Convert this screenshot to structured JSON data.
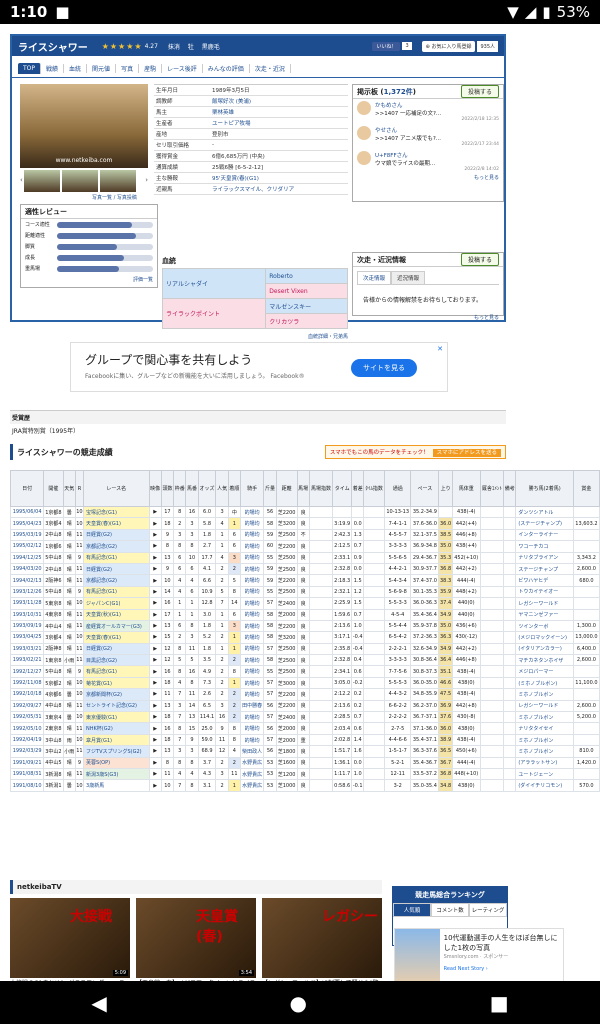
{
  "status": {
    "time": "1:10",
    "battery": "53%"
  },
  "horse": {
    "name": "ライスシャワー",
    "stars": "★★★★★",
    "rating": "4.27",
    "status": "抹消",
    "sex": "牡",
    "color": "黒鹿毛",
    "like_label": "いいね！",
    "like_count": "3",
    "fav_label": "お気に入り馬登録",
    "fav_count": "935人"
  },
  "tabs": [
    "TOP",
    "戦績",
    "血統",
    "関元値",
    "写真",
    "産駒",
    "レース後評",
    "みんなの評価",
    "次走・近況"
  ],
  "profile": [
    {
      "k": "生年月日",
      "v": "1989年3月5日",
      "plain": true
    },
    {
      "k": "調教師",
      "v": "飯塚好次 (美浦)"
    },
    {
      "k": "馬主",
      "v": "栗林英雄"
    },
    {
      "k": "生産者",
      "v": "ユートピア牧場"
    },
    {
      "k": "産地",
      "v": "登別市",
      "plain": true
    },
    {
      "k": "セリ取引価格",
      "v": "-",
      "plain": true
    },
    {
      "k": "獲得賞金",
      "v": "6億6,685万円 (中央)",
      "plain": true
    },
    {
      "k": "通算成績",
      "v": "25戦6勝 [6-5-2-12]",
      "plain": true
    },
    {
      "k": "主な勝鞍",
      "v": "95'天皇賞(春)(G1)"
    },
    {
      "k": "近親馬",
      "v": "ライラックスマイル、クリダリア"
    }
  ],
  "photo": {
    "watermark": "www.netkeiba.com",
    "links": "写真一覧 / 写真投稿"
  },
  "board": {
    "title": "掲示板",
    "count": "1,372件",
    "post_button": "投稿する",
    "posts": [
      {
        "user": "かもめさん",
        "msg": ">>1407 一応補足の文?...",
        "date": "2022/2/18 12:35"
      },
      {
        "user": "やせさん",
        "msg": ">>1407 アニメ版でも?...",
        "date": "2022/2/17 23:44"
      },
      {
        "user": "U+F8FFさん",
        "msg": "ウマ娘でライスの最期...",
        "date": "2022/2/8 14:02"
      }
    ],
    "more": "もっと見る"
  },
  "review": {
    "title": "適性レビュー",
    "rows": [
      {
        "k": "コース適性",
        "v": 0.78
      },
      {
        "k": "距離適性",
        "v": 0.82
      },
      {
        "k": "脚質",
        "v": 0.62
      },
      {
        "k": "成長",
        "v": 0.7
      },
      {
        "k": "重馬場",
        "v": 0.65
      }
    ],
    "link": "評価一覧"
  },
  "pedigree": {
    "title": "血統",
    "sire": "リアルシャダイ",
    "dam": "ライラックポイント",
    "ss": "Roberto",
    "sd": "Desert Vixen",
    "ds": "マルゼンスキー",
    "dd": "クリカツラ",
    "link": "血統詳細・兄弟馬"
  },
  "nextrace": {
    "title": "次走・近況情報",
    "post_button": "投稿する",
    "tabs": [
      "次走情報",
      "近況情報"
    ],
    "message": "告様からの情報解禁をお待ちしております。",
    "more": "もっと見る"
  },
  "ad": {
    "headline": "グループで関心事を共有しよう",
    "sub": "Facebookに集い、グループなどの新機能を大いに活用しましょう。 Facebook®",
    "cta": "サイトを見る",
    "close": "✕"
  },
  "prize": {
    "title": "受賞歴",
    "value": "JRA賞特別賞（1995年）"
  },
  "results": {
    "title": "ライスシャワーの競走成績",
    "promo": "スマホでもこの馬のデータをチェック！",
    "promo_btn": "スマホにアドレスを送る",
    "headers": [
      "日付",
      "開催",
      "天気",
      "R",
      "レース名",
      "映像",
      "頭数",
      "枠番",
      "馬番",
      "オッズ",
      "人気",
      "着順",
      "騎手",
      "斤量",
      "距離",
      "馬場",
      "馬場指数",
      "タイム",
      "着差",
      "ﾀｲﾑ指数",
      "通過",
      "ペース",
      "上り",
      "馬体重",
      "厩舎ｺﾒﾝﾄ",
      "備考",
      "勝ち馬(2着馬)",
      "賞金"
    ],
    "rows": [
      [
        "1995/06/04",
        "1京都8",
        "曇",
        "10",
        "宝塚記念(G1)",
        "G1",
        "17",
        "8",
        "16",
        "6.0",
        "3",
        "中",
        "的場均",
        "56",
        "芝2200",
        "良",
        "",
        "",
        "",
        "",
        "10-13-13",
        "35.2-34.9",
        "",
        "438(-4)",
        "",
        "",
        "ダンツシアトル",
        ""
      ],
      [
        "1995/04/23",
        "3京都4",
        "晴",
        "10",
        "天皇賞(春)(G1)",
        "G1",
        "18",
        "2",
        "3",
        "5.8",
        "4",
        "1",
        "的場均",
        "58",
        "芝3200",
        "良",
        "",
        "3:19.9",
        "0.0",
        "",
        "7-4-1-1",
        "37.6-36.0",
        "36.0",
        "442(+4)",
        "",
        "",
        "(ステージチャンプ)",
        "13,603.2"
      ],
      [
        "1995/03/19",
        "2中山8",
        "晴",
        "11",
        "日経賞(G2)",
        "G2",
        "9",
        "3",
        "3",
        "1.8",
        "1",
        "6",
        "的場均",
        "59",
        "芝2500",
        "不",
        "",
        "2:42.3",
        "1.3",
        "",
        "4-5-5-7",
        "32.1-37.5",
        "38.5",
        "446(+8)",
        "",
        "",
        "インターライナー",
        ""
      ],
      [
        "1995/02/12",
        "1京都6",
        "晴",
        "11",
        "京都記念(G2)",
        "G2",
        "8",
        "8",
        "8",
        "2.7",
        "1",
        "6",
        "的場均",
        "60",
        "芝2200",
        "良",
        "",
        "2:12.5",
        "0.7",
        "",
        "3-3-3-3",
        "36.9-34.8",
        "35.0",
        "438(+4)",
        "",
        "",
        "ワコーチカコ",
        ""
      ],
      [
        "1994/12/25",
        "5中山8",
        "晴",
        "9",
        "有馬記念(G1)",
        "G1",
        "13",
        "6",
        "10",
        "17.7",
        "4",
        "3",
        "的場均",
        "55",
        "芝2500",
        "良",
        "",
        "2:33.1",
        "0.9",
        "",
        "5-5-6-5",
        "29.4-36.7",
        "35.3",
        "452(+10)",
        "",
        "",
        "ナリタブライアン",
        "3,343.2"
      ],
      [
        "1994/03/20",
        "2中山8",
        "晴",
        "11",
        "日経賞(G2)",
        "G2",
        "9",
        "6",
        "6",
        "4.1",
        "2",
        "2",
        "的場均",
        "59",
        "芝2500",
        "良",
        "",
        "2:32.8",
        "0.0",
        "",
        "4-4-2-1",
        "30.9-37.7",
        "36.8",
        "442(+2)",
        "",
        "",
        "ステージチャンプ",
        "2,600.0"
      ],
      [
        "1994/02/13",
        "2阪神6",
        "晴",
        "11",
        "京都記念(G2)",
        "G2",
        "10",
        "4",
        "4",
        "6.6",
        "2",
        "5",
        "的場均",
        "59",
        "芝2200",
        "良",
        "",
        "2:18.3",
        "1.5",
        "",
        "5-4-3-4",
        "37.4-37.0",
        "38.3",
        "444(-4)",
        "",
        "",
        "ビワハヤヒデ",
        "680.0"
      ],
      [
        "1993/12/26",
        "5中山8",
        "晴",
        "9",
        "有馬記念(G1)",
        "G1",
        "14",
        "4",
        "6",
        "10.9",
        "5",
        "8",
        "的場均",
        "55",
        "芝2500",
        "良",
        "",
        "2:32.1",
        "1.2",
        "",
        "5-6-9-8",
        "30.1-35.3",
        "35.9",
        "448(+2)",
        "",
        "",
        "トウカイテイオー",
        ""
      ],
      [
        "1993/11/28",
        "5東京8",
        "晴",
        "10",
        "ジャパンC(G1)",
        "G1",
        "16",
        "1",
        "1",
        "12.8",
        "7",
        "14",
        "的場均",
        "57",
        "芝2400",
        "良",
        "",
        "2:25.9",
        "1.5",
        "",
        "5-5-3-3",
        "36.0-36.3",
        "37.4",
        "440(0)",
        "",
        "",
        "レガシーワールド",
        ""
      ],
      [
        "1993/10/31",
        "4東京8",
        "晴",
        "11",
        "天皇賞(秋)(G1)",
        "G1",
        "17",
        "1",
        "1",
        "3.0",
        "1",
        "6",
        "的場均",
        "58",
        "芝2000",
        "良",
        "",
        "1:59.6",
        "0.7",
        "",
        "4-5-4",
        "35.4-36.4",
        "34.9",
        "440(0)",
        "",
        "",
        "ヤマニンゼファー",
        ""
      ],
      [
        "1993/09/19",
        "4中山4",
        "晴",
        "11",
        "産経賞オールカマー(G3)",
        "G3",
        "13",
        "6",
        "8",
        "1.8",
        "1",
        "3",
        "的場均",
        "58",
        "芝2200",
        "良",
        "",
        "2:13.6",
        "1.0",
        "",
        "5-5-4-4",
        "35.9-37.8",
        "35.0",
        "436(+6)",
        "",
        "",
        "ツインターボ",
        "1,300.0"
      ],
      [
        "1993/04/25",
        "3京都4",
        "晴",
        "10",
        "天皇賞(春)(G1)",
        "G1",
        "15",
        "2",
        "3",
        "5.2",
        "2",
        "1",
        "的場均",
        "58",
        "芝3200",
        "良",
        "",
        "3:17.1",
        "-0.4",
        "",
        "6-5-4-2",
        "37.2-36.3",
        "36.3",
        "430(-12)",
        "",
        "",
        "(メジロマックイーン)",
        "13,000.0"
      ],
      [
        "1993/03/21",
        "2阪神8",
        "晴",
        "11",
        "日経賞(G2)",
        "G2",
        "12",
        "8",
        "11",
        "1.8",
        "1",
        "1",
        "的場均",
        "57",
        "芝2500",
        "良",
        "",
        "2:35.8",
        "-0.4",
        "",
        "2-2-2-1",
        "32.6-34.9",
        "34.9",
        "442(+2)",
        "",
        "",
        "(イタリアンカラー)",
        "6,400.0"
      ],
      [
        "1993/02/21",
        "1東京8",
        "小雨",
        "11",
        "目黒記念(G2)",
        "G2",
        "12",
        "5",
        "5",
        "3.5",
        "2",
        "2",
        "的場均",
        "58",
        "芝2500",
        "良",
        "",
        "2:32.8",
        "0.4",
        "",
        "3-3-3-3",
        "30.8-36.4",
        "36.4",
        "446(+8)",
        "",
        "",
        "マチカネタンホイザ",
        "2,600.0"
      ],
      [
        "1992/12/27",
        "5中山8",
        "晴",
        "9",
        "有馬記念(G1)",
        "G1",
        "16",
        "8",
        "16",
        "4.9",
        "2",
        "8",
        "的場均",
        "55",
        "芝2500",
        "良",
        "",
        "2:34.1",
        "0.6",
        "",
        "7-7-5-6",
        "30.8-37.3",
        "35.1",
        "438(-4)",
        "",
        "",
        "メジロパーマー",
        ""
      ],
      [
        "1992/11/08",
        "5京都2",
        "晴",
        "10",
        "菊花賞(G1)",
        "G1",
        "18",
        "4",
        "8",
        "7.3",
        "2",
        "1",
        "的場均",
        "57",
        "芝3000",
        "良",
        "",
        "3:05.0",
        "-0.2",
        "",
        "5-5-5-3",
        "36.0-35.0",
        "46.6",
        "438(0)",
        "",
        "",
        "(ミホノブルボン)",
        "11,100.0"
      ],
      [
        "1992/10/18",
        "4京都6",
        "曇",
        "10",
        "京都新聞杯(G2)",
        "G2",
        "11",
        "7",
        "11",
        "2.6",
        "2",
        "2",
        "的場均",
        "57",
        "芝2200",
        "良",
        "",
        "2:12.2",
        "0.2",
        "",
        "4-4-3-2",
        "34.8-35.9",
        "47.5",
        "438(-4)",
        "",
        "",
        "ミホノブルボン",
        ""
      ],
      [
        "1992/09/27",
        "4中山8",
        "晴",
        "11",
        "セントライト記念(G2)",
        "G2",
        "13",
        "3",
        "14",
        "6.5",
        "3",
        "2",
        "田中勝春",
        "56",
        "芝2200",
        "良",
        "",
        "2:13.6",
        "0.2",
        "",
        "6-6-2-2",
        "36.2-37.0",
        "36.9",
        "442(+8)",
        "",
        "",
        "レガシーワールド",
        "2,600.0"
      ],
      [
        "1992/05/31",
        "3東京4",
        "曇",
        "10",
        "東京優駿(G1)",
        "G1",
        "18",
        "7",
        "13",
        "114.1",
        "16",
        "2",
        "的場均",
        "57",
        "芝2400",
        "良",
        "",
        "2:28.5",
        "0.7",
        "",
        "2-2-2-2",
        "36.7-37.1",
        "37.6",
        "430(-8)",
        "",
        "",
        "ミホノブルボン",
        "5,200.0"
      ],
      [
        "1992/05/10",
        "2東京8",
        "晴",
        "11",
        "NHK杯(G2)",
        "G2",
        "16",
        "8",
        "15",
        "25.0",
        "9",
        "8",
        "的場均",
        "56",
        "芝2000",
        "良",
        "",
        "2:03.4",
        "0.6",
        "",
        "2-7-5",
        "37.1-36.0",
        "36.0",
        "438(0)",
        "",
        "",
        "ナリタタイセイ",
        ""
      ],
      [
        "1992/04/19",
        "3中山8",
        "雨",
        "10",
        "皐月賞(G1)",
        "G1",
        "18",
        "7",
        "9",
        "59.0",
        "11",
        "8",
        "的場均",
        "57",
        "芝2000",
        "重",
        "",
        "2:02.8",
        "1.4",
        "",
        "4-4-6-6",
        "35.4-37.1",
        "38.9",
        "438(-4)",
        "",
        "",
        "ミホノブルボン",
        ""
      ],
      [
        "1992/03/29",
        "3中山2",
        "小雨",
        "11",
        "フジTVスプリングS(G2)",
        "G2",
        "13",
        "3",
        "3",
        "68.9",
        "12",
        "4",
        "柴田政人",
        "56",
        "芝1800",
        "良",
        "",
        "1:51.7",
        "1.6",
        "",
        "1-5-1-7",
        "36.3-37.6",
        "36.5",
        "450(+6)",
        "",
        "",
        "ミホノブルボン",
        "810.0"
      ],
      [
        "1991/09/21",
        "4中山5",
        "晴",
        "9",
        "芙蓉S(OP)",
        "OP",
        "8",
        "8",
        "8",
        "3.7",
        "2",
        "2",
        "水野貴広",
        "53",
        "芝1600",
        "良",
        "",
        "1:36.1",
        "0.0",
        "",
        "5-2-1",
        "35.4-36.7",
        "36.7",
        "444(-4)",
        "",
        "",
        "(アララットサン)",
        "1,420.0"
      ],
      [
        "1991/08/31",
        "3新潟8",
        "晴",
        "11",
        "新潟3歳S(G3)",
        "G3",
        "11",
        "4",
        "4",
        "4.3",
        "3",
        "11",
        "水野貴広",
        "53",
        "芝1200",
        "良",
        "",
        "1:11.7",
        "1.0",
        "",
        "12-11",
        "33.5-37.2",
        "36.8",
        "448(+10)",
        "",
        "",
        "ユートジェーン",
        ""
      ],
      [
        "1991/08/10",
        "3新潟1",
        "曇",
        "10",
        "3歳新馬",
        "",
        "10",
        "7",
        "8",
        "3.1",
        "2",
        "1",
        "水野貴広",
        "53",
        "芝1000",
        "良",
        "",
        "0:58.6",
        "-0.1",
        "",
        "3-2",
        "35.0-35.4",
        "34.8",
        "438(0)",
        "",
        "",
        "(ダイイチリコモン)",
        "570.0"
      ]
    ]
  },
  "tv": {
    "title": "netkeibaTV",
    "cards": [
      {
        "overlay": "大接戦",
        "duration": "5:09",
        "caption": "大接戦のG1まとめ！ グラスワンダーvs スペシャルウィークなど名勝負を一挙振り返"
      },
      {
        "overlay": "天皇賞(春)",
        "duration": "3:54",
        "caption": "【天皇賞・春】メジロマックイーンとライスシャワー、平成最強ステイヤーたちの名"
      },
      {
        "overlay": "レガシー",
        "duration": "",
        "caption": "【レガシーワールド】JC制覇して騒せた\"驚異の二の脚\""
      }
    ]
  },
  "ranking": {
    "title": "競走馬総合ランキング",
    "tabs": [
      "人気順",
      "コメント数",
      "レーティング"
    ]
  },
  "ad2": {
    "text": "10代運動選手の人生をほぼ台無しにした1枚の写真",
    "sponsor": "Smsnlory.com · スポンサー",
    "more": "Read Next Story ›"
  }
}
